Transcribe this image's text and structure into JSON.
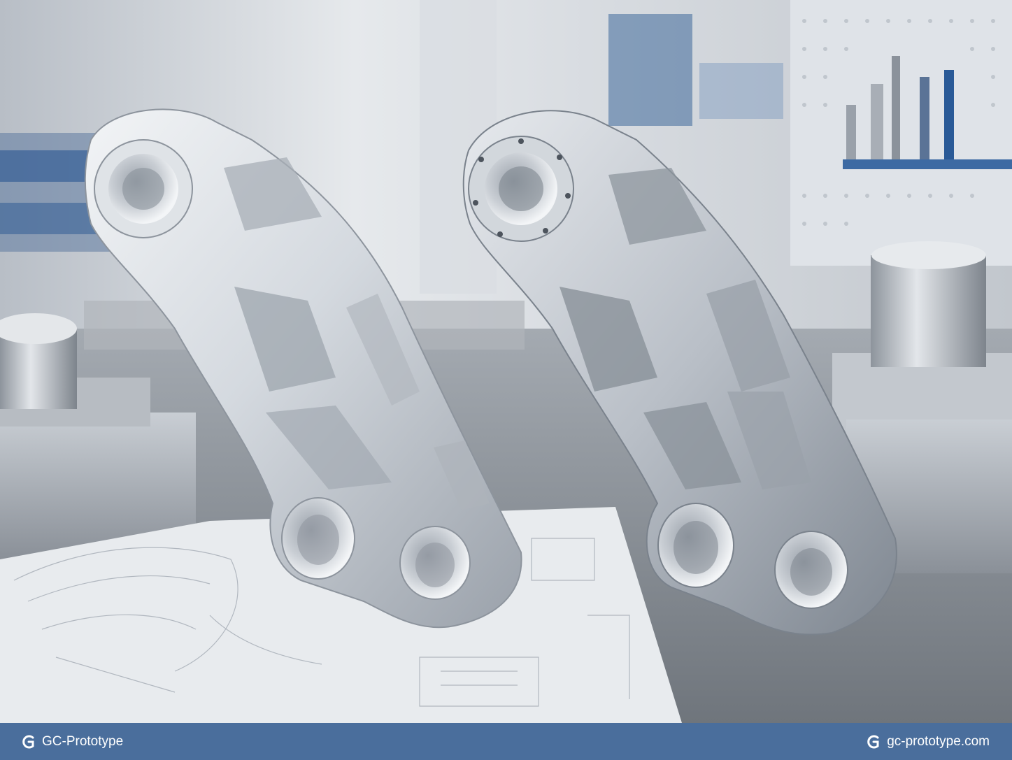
{
  "footer": {
    "left_label": "GC-Prototype",
    "right_label": "gc-prototype.com",
    "logo_icon": "gc-logo-icon",
    "background": "#4a6e9c",
    "text_color": "#ffffff"
  },
  "scene": {
    "subject": "two-machined-aluminum-brackets",
    "palette": {
      "metal": "#d7dce2",
      "metal_dark": "#8c949e",
      "table": "#8f959c",
      "paper": "#e9ecef",
      "accent_blue": "#1f4f8e"
    }
  }
}
